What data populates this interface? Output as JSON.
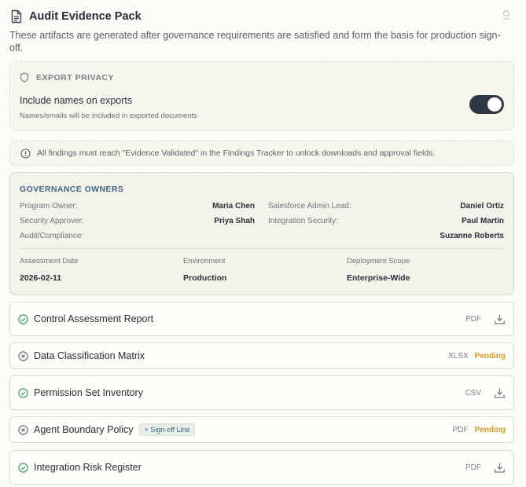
{
  "header": {
    "title": "Audit Evidence Pack",
    "description": "These artifacts are generated after governance requirements are satisfied and form the basis for production sign-off."
  },
  "privacy": {
    "heading": "EXPORT PRIVACY",
    "toggle_label": "Include names on exports",
    "toggle_sub": "Names/emails will be included in exported documents",
    "toggle_on": true
  },
  "notice": {
    "text": "All findings must reach \"Evidence Validated\" in the Findings Tracker to unlock downloads and approval fields."
  },
  "governance": {
    "heading": "GOVERNANCE OWNERS",
    "owners": [
      {
        "role": "Program Owner:",
        "name": "Maria Chen"
      },
      {
        "role": "Salesforce Admin Lead:",
        "name": "Daniel Ortiz"
      },
      {
        "role": "Security Approver:",
        "name": "Priya Shah"
      },
      {
        "role": "Integration Security:",
        "name": "Paul Martin"
      },
      {
        "role": "Audit/Compliance:",
        "name": "Suzanne Roberts"
      }
    ],
    "meta": [
      {
        "label": "Assessment Date",
        "value": "2026-02-11"
      },
      {
        "label": "Environment",
        "value": "Production"
      },
      {
        "label": "Deployment Scope",
        "value": "Enterprise-Wide"
      }
    ]
  },
  "artifacts": [
    {
      "name": "Control Assessment Report",
      "format": "PDF",
      "status": "ready",
      "chip": ""
    },
    {
      "name": "Data Classification Matrix",
      "format": "XLSX",
      "status": "Pending",
      "chip": ""
    },
    {
      "name": "Permission Set Inventory",
      "format": "CSV",
      "status": "ready",
      "chip": ""
    },
    {
      "name": "Agent Boundary Policy",
      "format": "PDF",
      "status": "Pending",
      "chip": "+ Sign-off Line"
    },
    {
      "name": "Integration Risk Register",
      "format": "PDF",
      "status": "ready",
      "chip": ""
    }
  ],
  "colors": {
    "ready": "#3d9a6a",
    "pending": "#d69a2a",
    "blocked": "#6b7079",
    "accent": "#3f6584"
  }
}
